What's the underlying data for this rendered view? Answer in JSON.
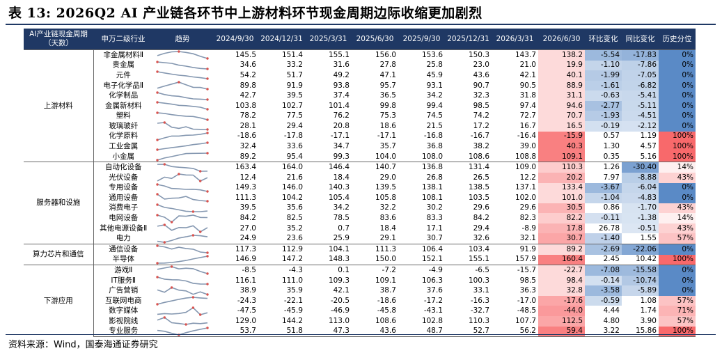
{
  "title": "表 13:  2026Q2 AI 产业链各环节中上游材料环节现金周期边际收缩更加剧烈",
  "source": "资料来源：Wind，国泰海通证券研究",
  "headers": [
    "AI产业链现金周期\n（天数）",
    "申万二级行业",
    "趋势",
    "2024/9/30",
    "2024/12/31",
    "2025/3/31",
    "2025/6/30",
    "2025/9/30",
    "2025/12/31",
    "2026/3/31",
    "2026/6/30",
    "环比变化",
    "同比变化",
    "历史分位"
  ],
  "colors": {
    "header_bg": "#1f3864",
    "header_fg": "#ffffff",
    "high": "#f8696b",
    "low": "#5a8ac6",
    "neutral": "#ffffff",
    "sparkline": "#8497b0",
    "spark_dot": "#d9534f"
  },
  "groups": [
    {
      "name": "上游材料",
      "rows": [
        {
          "industry": "非金属材料Ⅱ",
          "values": [
            145.5,
            151.4,
            155.1,
            156.0,
            153.6,
            150.3,
            143.7,
            138.2
          ],
          "qoq": -5.54,
          "yoy": -17.83,
          "pct": "0%"
        },
        {
          "industry": "贵金属",
          "values": [
            34.6,
            33.2,
            31.6,
            27.8,
            25.8,
            23.0,
            21.0,
            19.9
          ],
          "qoq": -1.1,
          "yoy": -7.86,
          "pct": "0%"
        },
        {
          "industry": "元件",
          "values": [
            54.2,
            51.7,
            49.2,
            47.1,
            45.9,
            43.6,
            42.1,
            40.1
          ],
          "qoq": -1.99,
          "yoy": -7.05,
          "pct": "0%"
        },
        {
          "industry": "电子化学品Ⅱ",
          "values": [
            89.8,
            91.9,
            93.8,
            95.7,
            93.1,
            90.7,
            90.5,
            88.9
          ],
          "qoq": -1.61,
          "yoy": -6.82,
          "pct": "0%"
        },
        {
          "industry": "化学制品",
          "values": [
            42.7,
            39.5,
            37.4,
            36.5,
            34.2,
            32.3,
            31.8,
            31.1
          ],
          "qoq": -0.63,
          "yoy": -5.41,
          "pct": "0%"
        },
        {
          "industry": "金属新材料",
          "values": [
            103.8,
            102.7,
            101.4,
            99.8,
            99.4,
            98.5,
            97.4,
            94.6
          ],
          "qoq": -2.77,
          "yoy": -5.11,
          "pct": "0%"
        },
        {
          "industry": "塑料",
          "values": [
            78.2,
            77.5,
            76.2,
            75.3,
            74.5,
            74.2,
            72.7,
            70.7
          ],
          "qoq": -1.93,
          "yoy": -4.51,
          "pct": "0%"
        },
        {
          "industry": "玻璃玻纤",
          "values": [
            28.1,
            29.4,
            20.8,
            18.6,
            21.5,
            17.2,
            16.7,
            16.5
          ],
          "qoq": -0.19,
          "yoy": -2.12,
          "pct": "0%"
        },
        {
          "industry": "化学原料",
          "values": [
            -18.6,
            -17.8,
            -17.1,
            -17.1,
            -16.8,
            -16.7,
            -16.4,
            -15.9
          ],
          "qoq": 0.57,
          "yoy": 1.19,
          "pct": "100%"
        },
        {
          "industry": "工业金属",
          "values": [
            32.4,
            33.6,
            34.7,
            35.7,
            36.8,
            38.2,
            39.0,
            40.3
          ],
          "qoq": 1.3,
          "yoy": 4.57,
          "pct": "100%"
        },
        {
          "industry": "小金属",
          "values": [
            89.2,
            95.4,
            99.3,
            104.0,
            108.0,
            108.6,
            108.8,
            109.1
          ],
          "qoq": 0.35,
          "yoy": 5.16,
          "pct": "100%"
        }
      ]
    },
    {
      "name": "服务器和设施",
      "rows": [
        {
          "industry": "自动化设备",
          "values": [
            163.4,
            164.0,
            146.4,
            140.7,
            136.8,
            131.4,
            109.0,
            110.3
          ],
          "qoq": 1.26,
          "yoy": -30.4,
          "pct": "14%"
        },
        {
          "industry": "光伏设备",
          "values": [
            12.4,
            21.6,
            18.4,
            29.0,
            26.8,
            26.5,
            12.2,
            20.2
          ],
          "qoq": 7.97,
          "yoy": -8.88,
          "pct": "43%"
        },
        {
          "industry": "专用设备",
          "values": [
            149.3,
            146.0,
            140.3,
            139.5,
            138.1,
            138.5,
            137.1,
            133.4
          ],
          "qoq": -3.67,
          "yoy": -6.04,
          "pct": "0%"
        },
        {
          "industry": "通用设备",
          "values": [
            111.3,
            104.2,
            105.4,
            105.8,
            108.1,
            103.5,
            102.0,
            101.0
          ],
          "qoq": -1.04,
          "yoy": -4.83,
          "pct": "0%"
        },
        {
          "industry": "消费电子",
          "values": [
            39.5,
            35.6,
            34.2,
            32.2,
            30.2,
            29.6,
            29.6,
            30.5
          ],
          "qoq": 0.86,
          "yoy": -1.7,
          "pct": "43%"
        },
        {
          "industry": "电网设备",
          "values": [
            84.2,
            82.5,
            78.5,
            83.6,
            83.3,
            84.2,
            82.3,
            82.2
          ],
          "qoq": -0.11,
          "yoy": -1.38,
          "pct": "14%"
        },
        {
          "industry": "其他电源设备Ⅱ",
          "values": [
            27.0,
            35.2,
            0.7,
            18.4,
            17.1,
            29.4,
            -8.9,
            17.8
          ],
          "qoq": 26.78,
          "yoy": -0.51,
          "pct": "43%"
        },
        {
          "industry": "电力",
          "values": [
            24.9,
            23.6,
            25.9,
            29.1,
            30.7,
            32.6,
            32.1,
            30.7
          ],
          "qoq": -1.4,
          "yoy": 1.55,
          "pct": "57%"
        }
      ]
    },
    {
      "name": "算力芯片和通信",
      "rows": [
        {
          "industry": "通信设备",
          "values": [
            117.3,
            112.9,
            104.1,
            111.3,
            106.4,
            103.4,
            91.9,
            89.2
          ],
          "qoq": -2.69,
          "yoy": -22.06,
          "pct": "0%"
        },
        {
          "industry": "半导体",
          "values": [
            146.9,
            147.2,
            148.3,
            150.0,
            152.1,
            155.1,
            157.9,
            160.4
          ],
          "qoq": 2.45,
          "yoy": 10.42,
          "pct": "100%"
        }
      ]
    },
    {
      "name": "下游应用",
      "rows": [
        {
          "industry": "游戏Ⅱ",
          "values": [
            -8.5,
            -4.3,
            0.1,
            -7.2,
            -4.9,
            -6.5,
            -15.7,
            -22.7
          ],
          "qoq": -7.08,
          "yoy": -15.58,
          "pct": "0%"
        },
        {
          "industry": "IT服务Ⅱ",
          "values": [
            116.1,
            111.0,
            109.3,
            109.1,
            106.3,
            100.3,
            98.5,
            98.4
          ],
          "qoq": -0.14,
          "yoy": -10.74,
          "pct": "0%"
        },
        {
          "industry": "广告营销",
          "values": [
            38.9,
            35.9,
            42.1,
            38.7,
            37.6,
            33.1,
            36.3,
            32.8
          ],
          "qoq": -3.58,
          "yoy": -5.89,
          "pct": "0%"
        },
        {
          "industry": "互联网电商",
          "values": [
            -24.3,
            -22.1,
            -20.5,
            -18.6,
            -17.2,
            -16.3,
            -17.0,
            -17.6
          ],
          "qoq": -0.59,
          "yoy": 1.08,
          "pct": "57%"
        },
        {
          "industry": "数字媒体",
          "values": [
            -47.5,
            -45.9,
            -46.9,
            -45.8,
            -43.1,
            -32.7,
            -48.5,
            -44.0
          ],
          "qoq": 4.44,
          "yoy": 1.74,
          "pct": "71%"
        },
        {
          "industry": "影视院线",
          "values": [
            129.0,
            144.2,
            113.0,
            108.6,
            102.8,
            110.3,
            107.7,
            112.5
          ],
          "qoq": 4.8,
          "yoy": 3.9,
          "pct": "57%"
        },
        {
          "industry": "专业服务",
          "values": [
            53.7,
            51.8,
            47.3,
            43.6,
            48.7,
            52.7,
            56.2,
            59.4
          ],
          "qoq": 3.22,
          "yoy": 15.86,
          "pct": "100%"
        }
      ]
    }
  ]
}
